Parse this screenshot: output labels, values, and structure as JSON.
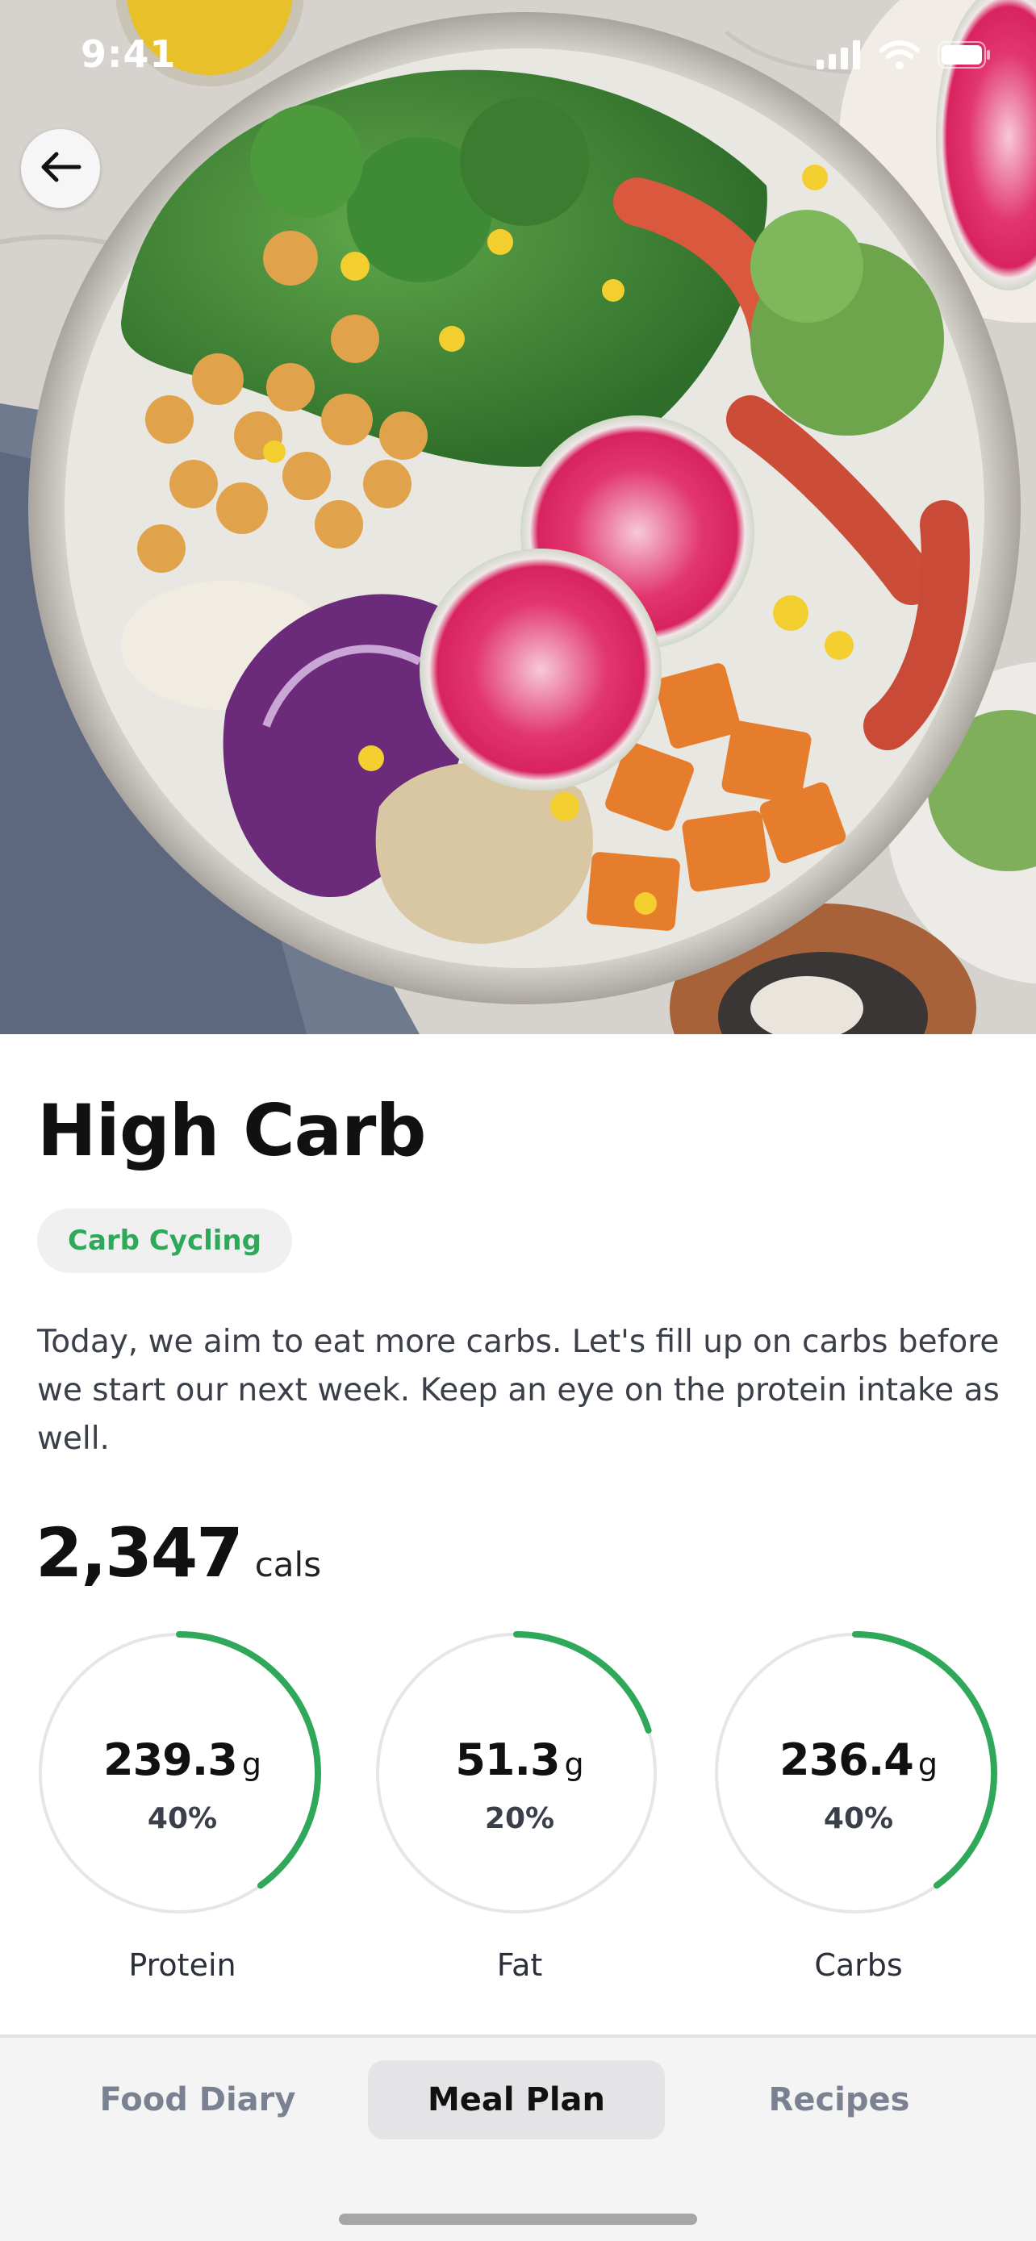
{
  "status_bar": {
    "time": "9:41",
    "icons": [
      "cellular-signal-icon",
      "wifi-icon",
      "battery-icon"
    ]
  },
  "hero": {
    "image": "buddha-bowl-photo"
  },
  "back_button": {
    "icon": "arrow-left-icon"
  },
  "meal": {
    "title": "High Carb",
    "tag": "Carb Cycling",
    "description": "Today, we aim to eat more carbs. Let's fill up on carbs before we start our next week. Keep an eye on the protein intake as well.",
    "calories": {
      "value": "2,347",
      "unit": "cals"
    }
  },
  "macros": [
    {
      "label": "Protein",
      "amount": "239.3",
      "unit": "g",
      "percent_label": "40%",
      "percent": 40
    },
    {
      "label": "Fat",
      "amount": "51.3",
      "unit": "g",
      "percent_label": "20%",
      "percent": 20
    },
    {
      "label": "Carbs",
      "amount": "236.4",
      "unit": "g",
      "percent_label": "40%",
      "percent": 40
    }
  ],
  "tabs": [
    {
      "label": "Food Diary",
      "active": false
    },
    {
      "label": "Meal Plan",
      "active": true
    },
    {
      "label": "Recipes",
      "active": false
    }
  ],
  "colors": {
    "accent": "#2fa85a",
    "ring_track": "#e6e6e6",
    "tag_background": "#f0f0f0",
    "tab_bar": "#f4f4f5"
  }
}
